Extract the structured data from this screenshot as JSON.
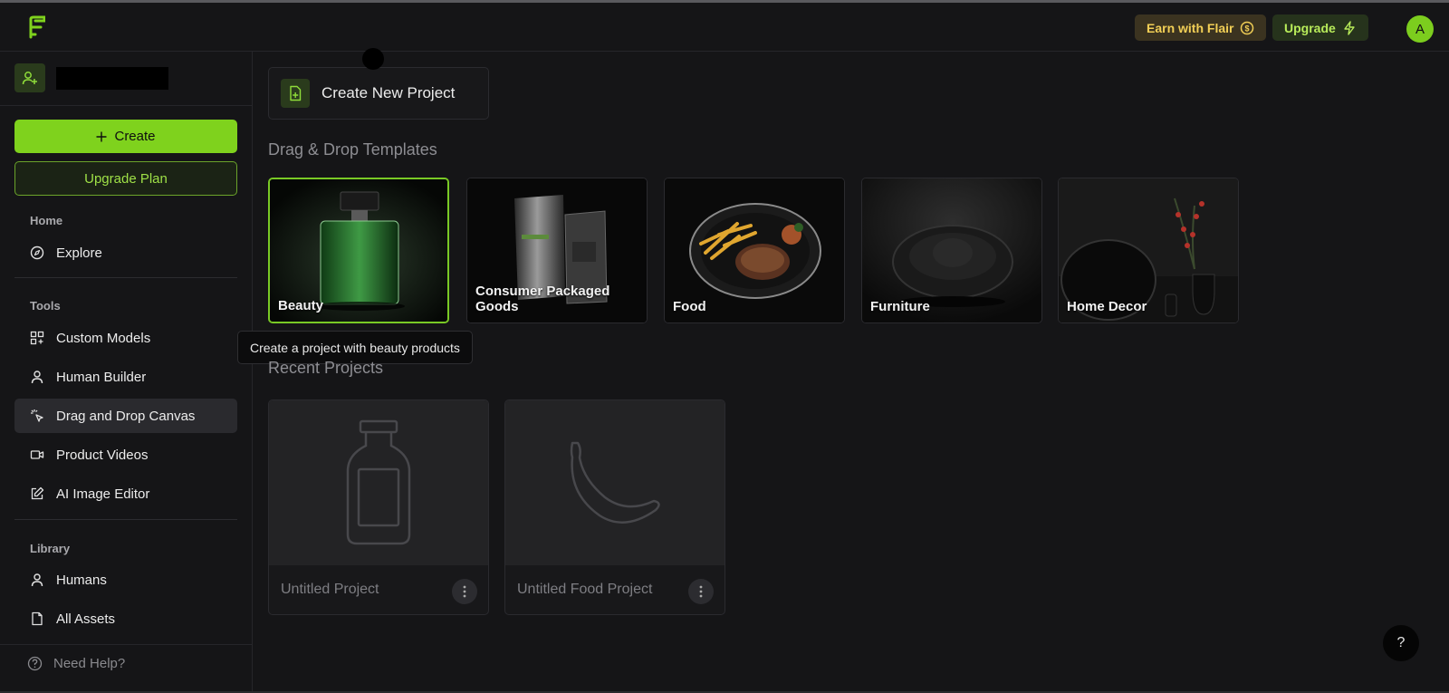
{
  "header": {
    "earn_label": "Earn with Flair",
    "upgrade_label": "Upgrade",
    "avatar_initial": "A"
  },
  "sidebar": {
    "create_label": "Create",
    "upgrade_plan_label": "Upgrade Plan",
    "sections": {
      "home": "Home",
      "tools": "Tools",
      "library": "Library"
    },
    "items": {
      "explore": "Explore",
      "custom_models": "Custom Models",
      "human_builder": "Human Builder",
      "drag_drop_canvas": "Drag and Drop Canvas",
      "product_videos": "Product Videos",
      "ai_image_editor": "AI Image Editor",
      "humans": "Humans",
      "all_assets": "All Assets"
    },
    "active_item": "Drag and Drop Canvas",
    "need_help": "Need Help?"
  },
  "main": {
    "create_new_project": "Create New Project",
    "templates_title": "Drag & Drop Templates",
    "templates": [
      {
        "label": "Beauty",
        "selected": true
      },
      {
        "label": "Consumer Packaged Goods",
        "selected": false
      },
      {
        "label": "Food",
        "selected": false
      },
      {
        "label": "Furniture",
        "selected": false
      },
      {
        "label": "Home Decor",
        "selected": false
      }
    ],
    "tooltip": "Create a project with beauty products",
    "recent_title": "Recent Projects",
    "projects": [
      {
        "title": "Untitled Project",
        "icon": "bottle-icon"
      },
      {
        "title": "Untitled Food Project",
        "icon": "banana-icon"
      }
    ],
    "help_fab": "?"
  },
  "colors": {
    "accent": "#7fd21d",
    "earn_text": "#f2cf56",
    "background": "#151517"
  }
}
